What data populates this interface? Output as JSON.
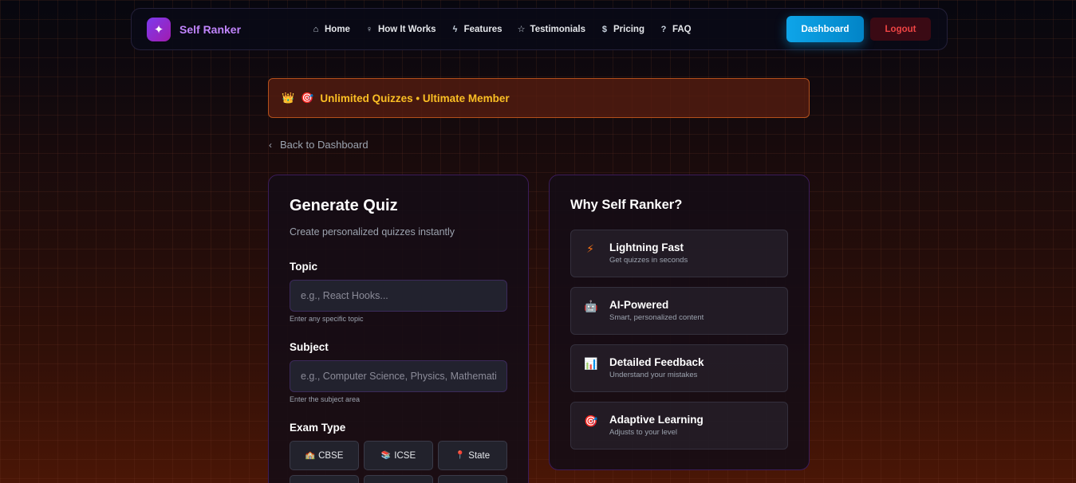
{
  "nav": {
    "brand": "Self Ranker",
    "links": [
      {
        "label": "Home",
        "icon": "home-icon",
        "glyph": "⌂"
      },
      {
        "label": "How It Works",
        "icon": "lightbulb-icon",
        "glyph": "♀"
      },
      {
        "label": "Features",
        "icon": "zap-icon",
        "glyph": "ϟ"
      },
      {
        "label": "Testimonials",
        "icon": "star-icon",
        "glyph": "☆"
      },
      {
        "label": "Pricing",
        "icon": "dollar-icon",
        "glyph": "$"
      },
      {
        "label": "FAQ",
        "icon": "help-circle-icon",
        "glyph": "?"
      }
    ],
    "dashboard_label": "Dashboard",
    "logout_label": "Logout"
  },
  "banner": {
    "text": "Unlimited Quizzes • Ultimate Member",
    "crown_glyph": "👑",
    "target_glyph": "🎯"
  },
  "back": {
    "label": "Back to Dashboard"
  },
  "generate": {
    "title": "Generate Quiz",
    "subtitle": "Create personalized quizzes instantly",
    "topic": {
      "label": "Topic",
      "placeholder": "e.g., React Hooks...",
      "hint": "Enter any specific topic"
    },
    "subject": {
      "label": "Subject",
      "placeholder": "e.g., Computer Science, Physics, Mathematics",
      "hint": "Enter the subject area"
    },
    "exam_type": {
      "label": "Exam Type",
      "options": [
        {
          "label": "CBSE",
          "glyph": "🏫"
        },
        {
          "label": "ICSE",
          "glyph": "📚"
        },
        {
          "label": "State",
          "glyph": "📍"
        },
        {
          "label": "",
          "glyph": ""
        },
        {
          "label": "",
          "glyph": ""
        },
        {
          "label": "",
          "glyph": ""
        }
      ]
    }
  },
  "why": {
    "title": "Why Self Ranker?",
    "features": [
      {
        "title": "Lightning Fast",
        "subtitle": "Get quizzes in seconds",
        "icon": "lightning-icon",
        "glyph": "⚡",
        "color": "#f97316"
      },
      {
        "title": "AI-Powered",
        "subtitle": "Smart, personalized content",
        "icon": "robot-icon",
        "glyph": "🤖",
        "color": "#ec4899"
      },
      {
        "title": "Detailed Feedback",
        "subtitle": "Understand your mistakes",
        "icon": "bar-chart-icon",
        "glyph": "📊",
        "color": "#3b82f6"
      },
      {
        "title": "Adaptive Learning",
        "subtitle": "Adjusts to your level",
        "icon": "target-icon",
        "glyph": "🎯",
        "color": "#ef4444"
      }
    ]
  },
  "colors": {
    "brand": "#c084fc",
    "accent": "#0ea5e9",
    "danger": "#ef4444",
    "banner_text": "#fbbf24"
  }
}
